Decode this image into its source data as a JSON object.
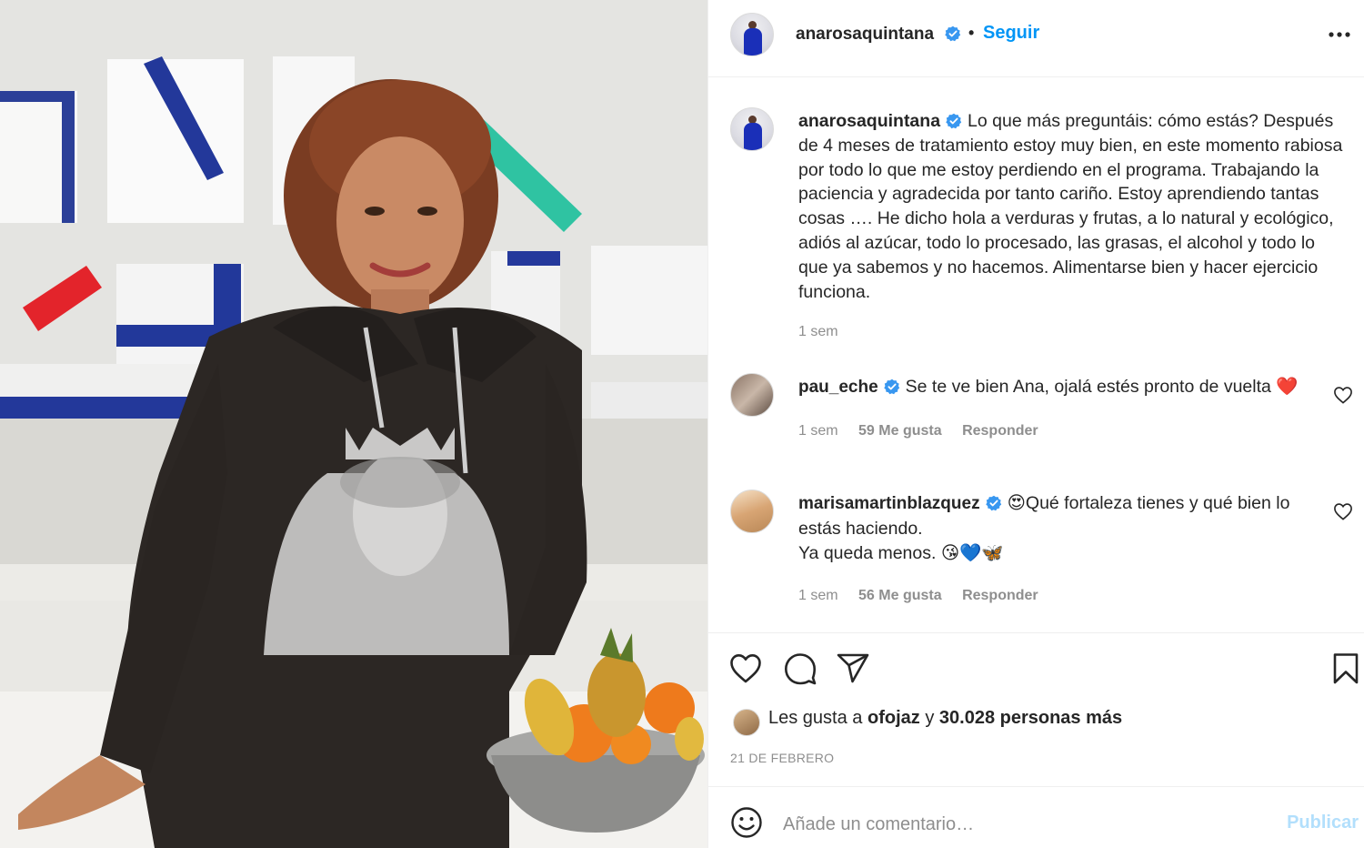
{
  "post": {
    "owner": {
      "username": "anarosaquintana",
      "verified": true
    },
    "header": {
      "separator": "•",
      "follow_label": "Seguir",
      "more_icon": "more-options-icon"
    },
    "caption": {
      "text": "Lo que más preguntáis: cómo estás? Después de 4 meses de tratamiento estoy muy bien, en este momento rabiosa por todo lo que me estoy perdiendo en el programa. Trabajando la paciencia y agradecida por tanto cariño. Estoy aprendiendo tantas cosas …. He dicho hola a verduras y frutas, a lo natural y ecológico, adiós al azúcar, todo lo procesado, las grasas, el alcohol y todo lo que ya sabemos y no hacemos. Alimentarse bien y hacer ejercicio funciona.",
      "time": "1 sem"
    },
    "comments": [
      {
        "username": "pau_eche",
        "verified": true,
        "text": "Se te ve bien Ana, ojalá estés pronto de vuelta ❤️",
        "time": "1 sem",
        "likes": "59 Me gusta",
        "reply_label": "Responder"
      },
      {
        "username": "marisamartinblazquez",
        "verified": true,
        "text": "😍Qué fortaleza tienes y qué bien lo estás haciendo.",
        "text2": "Ya queda menos. 😘💙🦋",
        "time": "1 sem",
        "likes": "56 Me gusta",
        "reply_label": "Responder"
      }
    ],
    "actions": {
      "icons": [
        "like-heart-icon",
        "comment-bubble-icon",
        "share-send-icon",
        "save-bookmark-icon"
      ]
    },
    "likes": {
      "prefix": "Les gusta a",
      "user": "ofojaz",
      "joiner": "y",
      "others": "30.028 personas más"
    },
    "date": "21 DE FEBRERO",
    "add_comment": {
      "placeholder": "Añade un comentario…",
      "submit_label": "Publicar",
      "emoji_icon": "emoji-smiley-icon"
    }
  },
  "colors": {
    "link_blue": "#0095f6",
    "verified_blue": "#3897f0",
    "muted": "#8e8e8e",
    "publish_disabled": "#b2dffc",
    "divider": "#efefef"
  }
}
